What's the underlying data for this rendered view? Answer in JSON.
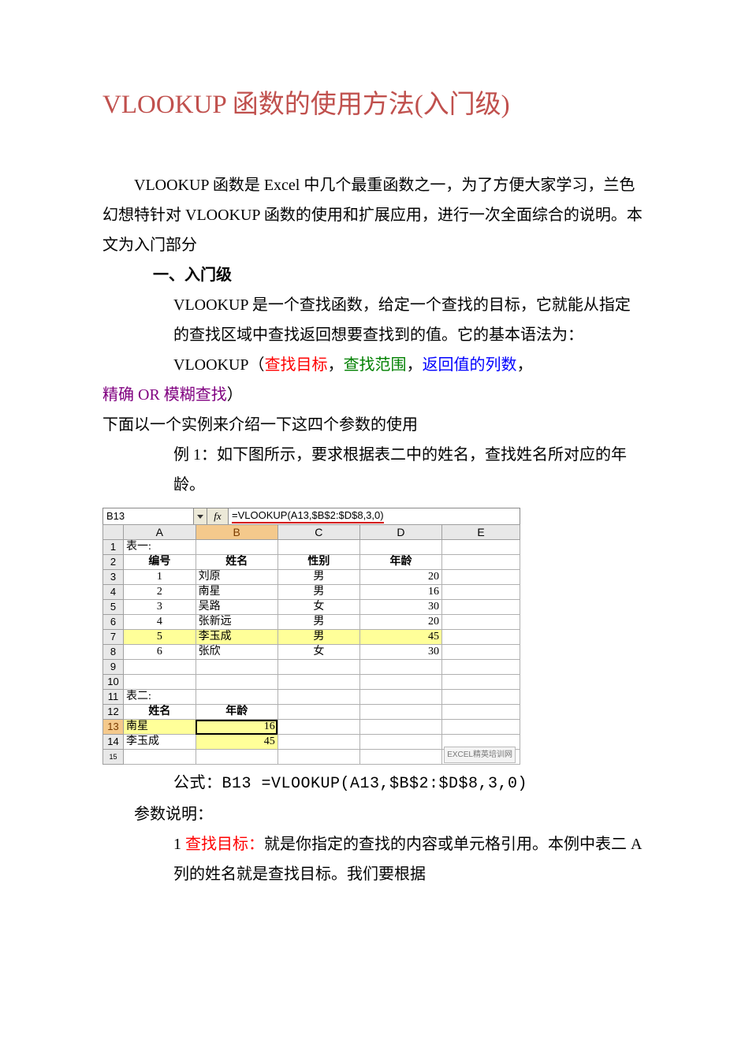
{
  "title": "VLOOKUP 函数的使用方法(入门级)",
  "intro": "VLOOKUP 函数是 Excel 中几个最重函数之一，为了方便大家学习，兰色幻想特针对 VLOOKUP 函数的使用和扩展应用，进行一次全面综合的说明。本文为入门部分",
  "section1_heading": "一、入门级",
  "section1_p1": "VLOOKUP 是一个查找函数，给定一个查找的目标，它就能从指定的查找区域中查找返回想要查找到的值。它的基本语法为：",
  "syntax": {
    "fn": "VLOOKUP（",
    "a1": "查找目标",
    "sep1": "，",
    "a2": "查找范围",
    "sep2": "，",
    "a3": "返回值的列数",
    "sep3": "，",
    "a4": "精确 OR 模糊查找",
    "close": "）"
  },
  "below_syntax": "下面以一个实例来介绍一下这四个参数的使用",
  "example_intro": "例 1：如下图所示，要求根据表二中的姓名，查找姓名所对应的年龄。",
  "excel": {
    "namebox": "B13",
    "fx_label": "fx",
    "formula": "=VLOOKUP(A13,$B$2:$D$8,3,0)",
    "columns": [
      "A",
      "B",
      "C",
      "D",
      "E"
    ],
    "rows": [
      {
        "n": "1",
        "cells": [
          "表一:",
          "",
          "",
          "",
          ""
        ]
      },
      {
        "n": "2",
        "cells": [
          "编号",
          "姓名",
          "性别",
          "年龄",
          ""
        ],
        "header": true
      },
      {
        "n": "3",
        "cells": [
          "1",
          "刘原",
          "男",
          "20",
          ""
        ]
      },
      {
        "n": "4",
        "cells": [
          "2",
          "南星",
          "男",
          "16",
          ""
        ]
      },
      {
        "n": "5",
        "cells": [
          "3",
          "吴路",
          "女",
          "30",
          ""
        ]
      },
      {
        "n": "6",
        "cells": [
          "4",
          "张新远",
          "男",
          "20",
          ""
        ]
      },
      {
        "n": "7",
        "cells": [
          "5",
          "李玉成",
          "男",
          "45",
          ""
        ],
        "highlight": true
      },
      {
        "n": "8",
        "cells": [
          "6",
          "张欣",
          "女",
          "30",
          ""
        ]
      },
      {
        "n": "9",
        "cells": [
          "",
          "",
          "",
          "",
          ""
        ]
      },
      {
        "n": "10",
        "cells": [
          "",
          "",
          "",
          "",
          ""
        ]
      },
      {
        "n": "11",
        "cells": [
          "表二:",
          "",
          "",
          "",
          ""
        ]
      },
      {
        "n": "12",
        "cells": [
          "姓名",
          "年龄",
          "",
          "",
          ""
        ],
        "header2": true
      },
      {
        "n": "13",
        "cells": [
          "南星",
          "16",
          "",
          "",
          ""
        ],
        "active": "B"
      },
      {
        "n": "14",
        "cells": [
          "李玉成",
          "45",
          "",
          "",
          ""
        ],
        "result": true
      },
      {
        "n": "15",
        "cells": [
          "",
          "",
          "",
          "",
          ""
        ]
      }
    ],
    "selected_row_header": "13",
    "selected_col_header": "B",
    "watermark": "EXCEL精英培训网"
  },
  "formula_line": "公式：B13 =VLOOKUP(A13,$B$2:$D$8,3,0)",
  "params_heading": "参数说明：",
  "param1": {
    "num": "1 ",
    "label": "查找目标：",
    "text": "就是你指定的查找的内容或单元格引用。本例中表二 A 列的姓名就是查找目标。我们要根据"
  }
}
